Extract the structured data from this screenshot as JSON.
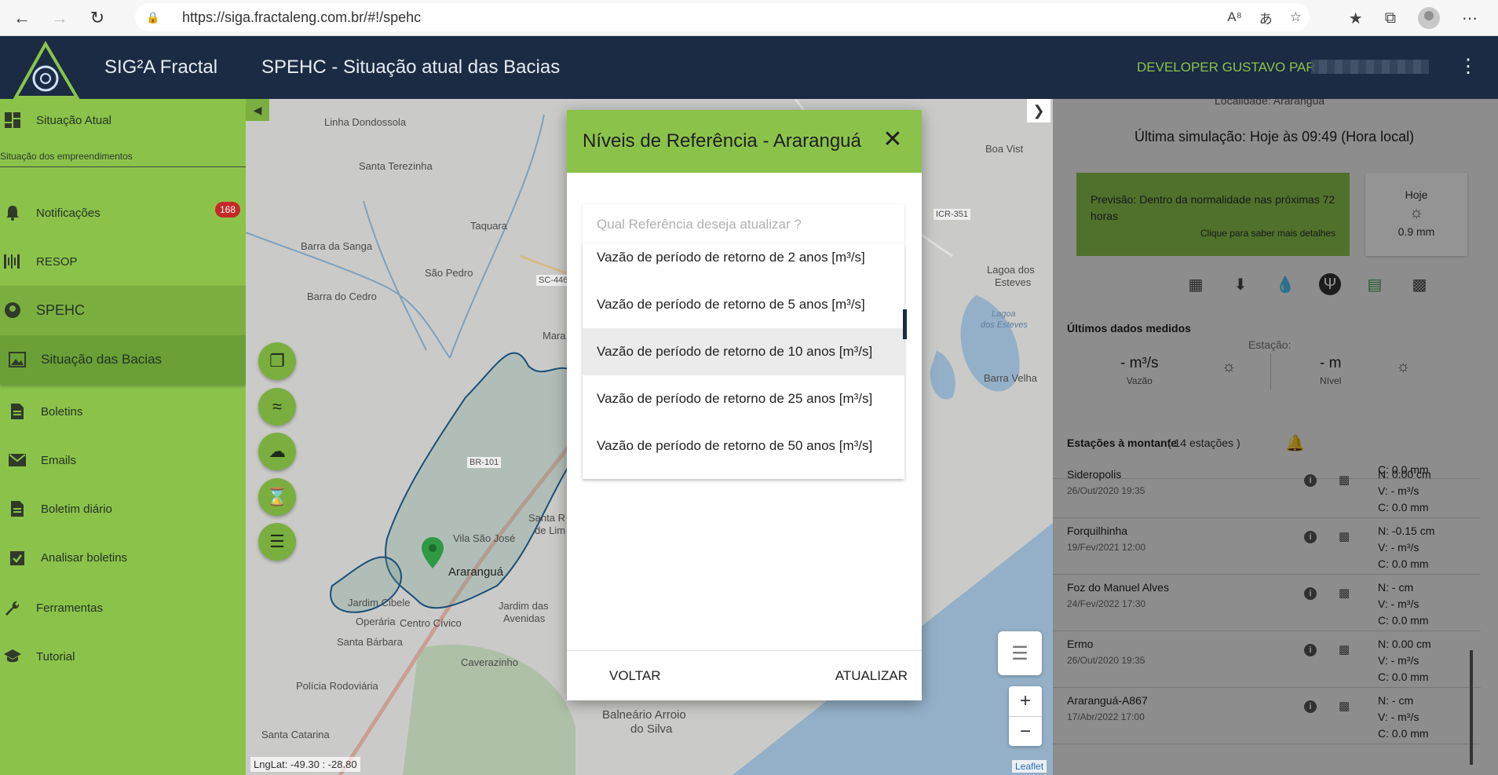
{
  "browser": {
    "url": "https://siga.fractaleng.com.br/#!/spehc"
  },
  "header": {
    "app_title": "SIG²A Fractal",
    "page_title": "SPEHC - Situação atual das Bacias",
    "user_name": "DEVELOPER GUSTAVO PAR"
  },
  "sidebar": {
    "items": [
      {
        "label": "Situação Atual",
        "icon": "dashboard-icon"
      },
      {
        "label": "Notificações",
        "icon": "bell-icon",
        "badge": "168"
      },
      {
        "label": "RESOP",
        "icon": "resop-icon"
      },
      {
        "label": "SPEHC",
        "icon": "spehc-icon"
      },
      {
        "label": "Situação das Bacias",
        "icon": "image-icon"
      },
      {
        "label": "Boletins",
        "icon": "document-icon"
      },
      {
        "label": "Emails",
        "icon": "mail-icon"
      },
      {
        "label": "Boletim diário",
        "icon": "document-icon"
      },
      {
        "label": "Analisar boletins",
        "icon": "checklist-icon"
      },
      {
        "label": "Ferramentas",
        "icon": "wrench-icon"
      },
      {
        "label": "Tutorial",
        "icon": "school-icon"
      }
    ],
    "subtitle": "Situação dos empreendimentos"
  },
  "map": {
    "labels": [
      "Linha Dondossola",
      "Santa Terezinha",
      "Taquara",
      "Barra da Sanga",
      "São Pedro",
      "Barra do Cedro",
      "SC-446",
      "Mara",
      "BR-101",
      "Vila São José",
      "Santa R",
      "de Lim",
      "Araranguá",
      "Jardim Cibele",
      "Jardim das",
      "Avenidas",
      "Operária",
      "Centro Cívico",
      "Santa Bárbara",
      "Caverazinho",
      "Polícia Rodoviária",
      "Santa Catarina",
      "Balneário Arroio",
      "do Silva",
      "Boa Vist",
      "ICR-351",
      "Lagoa dos",
      "Esteves",
      "Lagoa",
      "dos Esteves",
      "Barra Velha"
    ],
    "lnglat": "LngLat: -49.30 : -28.80",
    "attribution": "Leaflet",
    "zoom_in": "+",
    "zoom_out": "−"
  },
  "right_panel": {
    "locality": "Localidade: Araranguá",
    "last_simulation": "Última simulação: Hoje às 09:49 (Hora local)",
    "forecast": "Previsão: Dentro da normalidade nas próximas 72 horas",
    "forecast_link": "Clique para saber mais detalhes",
    "today_label": "Hoje",
    "today_value": "0.9 mm",
    "last_measured_title": "Últimos dados medidos",
    "station_label": "Estação:",
    "flow_value": "- m³/s",
    "flow_label": "Vazão",
    "level_value": "- m",
    "level_label": "Nível",
    "upstream_title": "Estações à montante",
    "upstream_count": "( 14 estações )",
    "partial_row": "C: 0.0 mm",
    "stations": [
      {
        "name": "Sideropolis",
        "date": "26/Out/2020 19:35",
        "n": "N: 0.00 cm",
        "v": "V: - m³/s",
        "c": "C: 0.0 mm"
      },
      {
        "name": "Forquilhinha",
        "date": "19/Fev/2021 12:00",
        "n": "N: -0.15 cm",
        "v": "V: - m³/s",
        "c": "C: 0.0 mm"
      },
      {
        "name": "Foz do Manuel Alves",
        "date": "24/Fev/2022 17:30",
        "n": "N: - cm",
        "v": "V: - m³/s",
        "c": "C: 0.0 mm"
      },
      {
        "name": "Ermo",
        "date": "26/Out/2020 19:35",
        "n": "N: 0.00 cm",
        "v": "V: - m³/s",
        "c": "C: 0.0 mm"
      },
      {
        "name": "Araranguá-A867",
        "date": "17/Abr/2022 17:00",
        "n": "N: - cm",
        "v": "V: - m³/s",
        "c": "C: 0.0 mm"
      }
    ]
  },
  "modal": {
    "title": "Níveis de Referência - Araranguá",
    "select_placeholder": "Qual Referência deseja atualizar ?",
    "options": [
      "Vazão de período de retorno de 2 anos [m³/s]",
      "Vazão de período de retorno de 5 anos [m³/s]",
      "Vazão de período de retorno de 10 anos [m³/s]",
      "Vazão de período de retorno de 25 anos [m³/s]",
      "Vazão de período de retorno de 50 anos [m³/s]"
    ],
    "highlighted_index": 2,
    "back_label": "VOLTAR",
    "update_label": "ATUALIZAR"
  },
  "colors": {
    "header_bg": "#1b2b44",
    "accent_green": "#8bc34a",
    "badge_red": "#c62828",
    "user_name": "#8bc34a"
  }
}
